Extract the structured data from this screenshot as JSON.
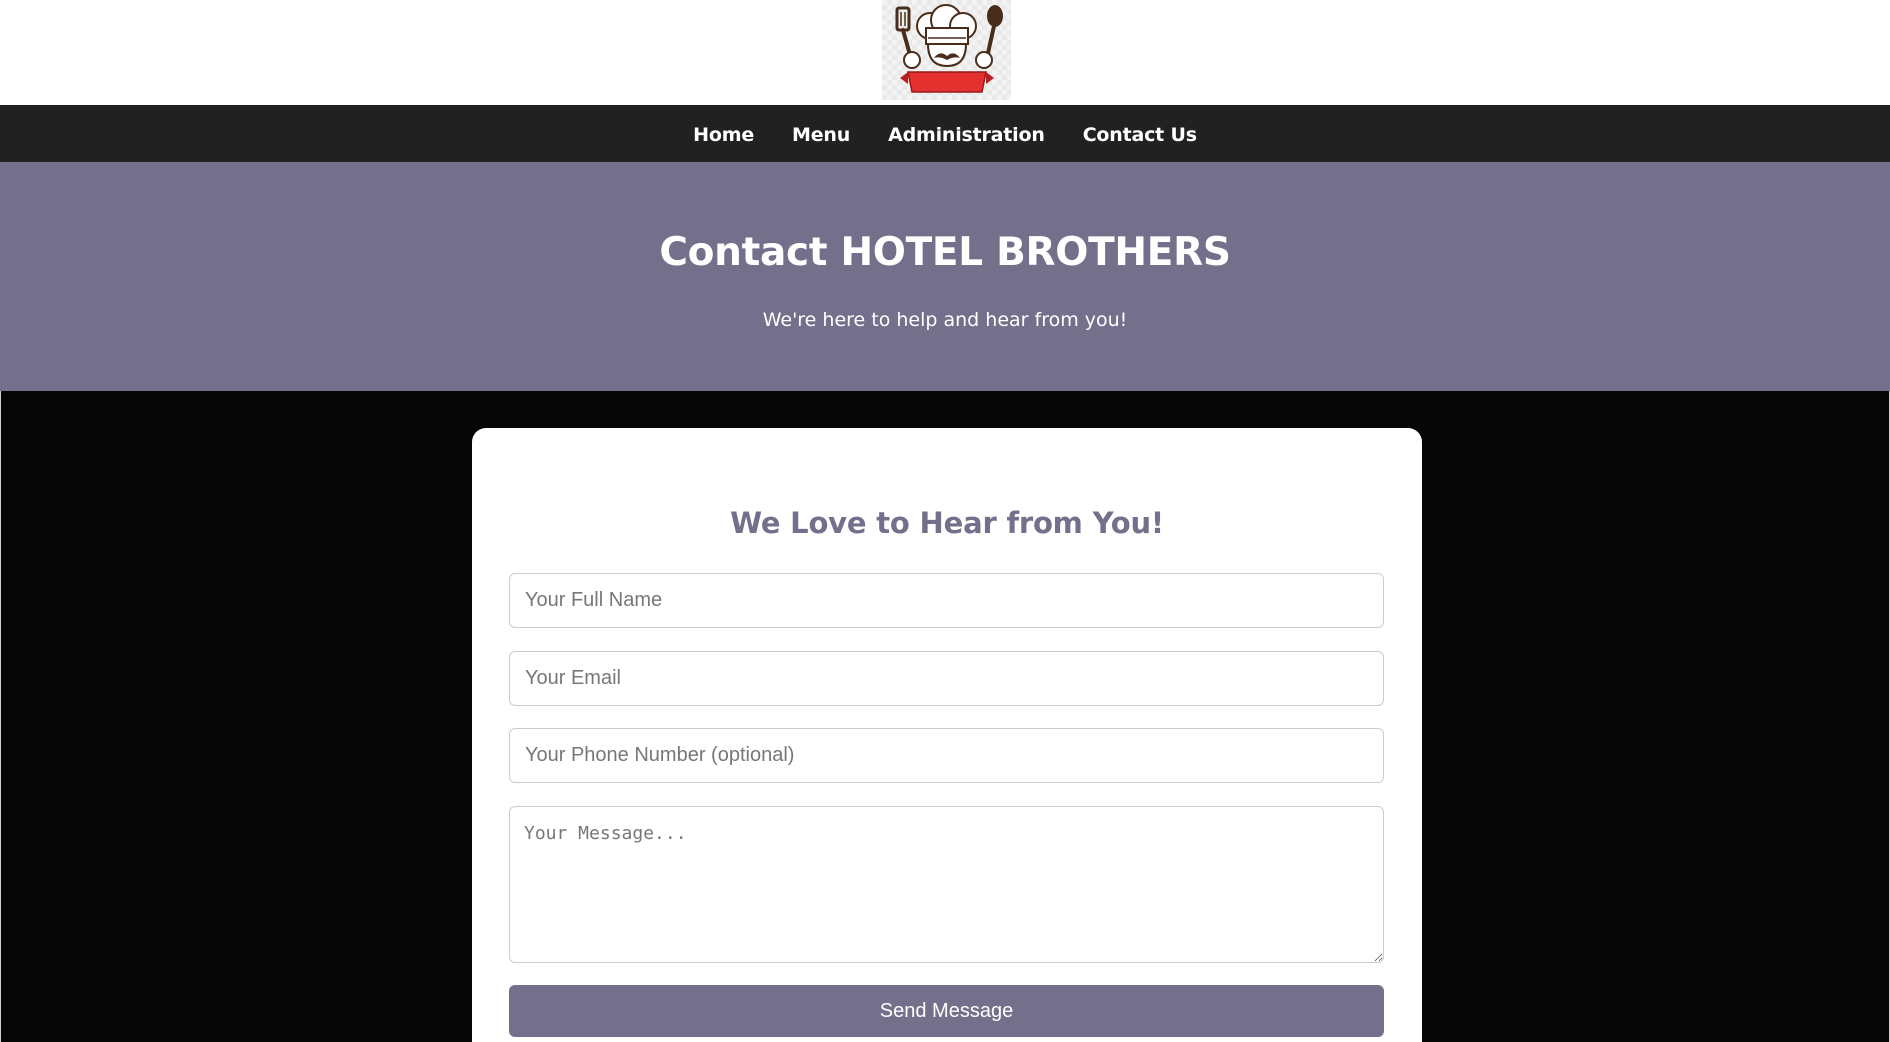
{
  "logo": {
    "icon": "chef-logo-icon"
  },
  "nav": {
    "items": [
      {
        "label": "Home"
      },
      {
        "label": "Menu"
      },
      {
        "label": "Administration"
      },
      {
        "label": "Contact Us"
      }
    ]
  },
  "hero": {
    "title": "Contact HOTEL BROTHERS",
    "subtitle": "We're here to help and hear from you!"
  },
  "form": {
    "title": "We Love to Hear from You!",
    "name_placeholder": "Your Full Name",
    "name_value": "",
    "email_placeholder": "Your Email",
    "email_value": "",
    "phone_placeholder": "Your Phone Number (optional)",
    "phone_value": "",
    "message_placeholder": "Your Message...",
    "message_value": "",
    "submit_label": "Send Message"
  },
  "colors": {
    "accent": "#746f8b",
    "nav_background": "#212121",
    "page_background": "#060606"
  }
}
